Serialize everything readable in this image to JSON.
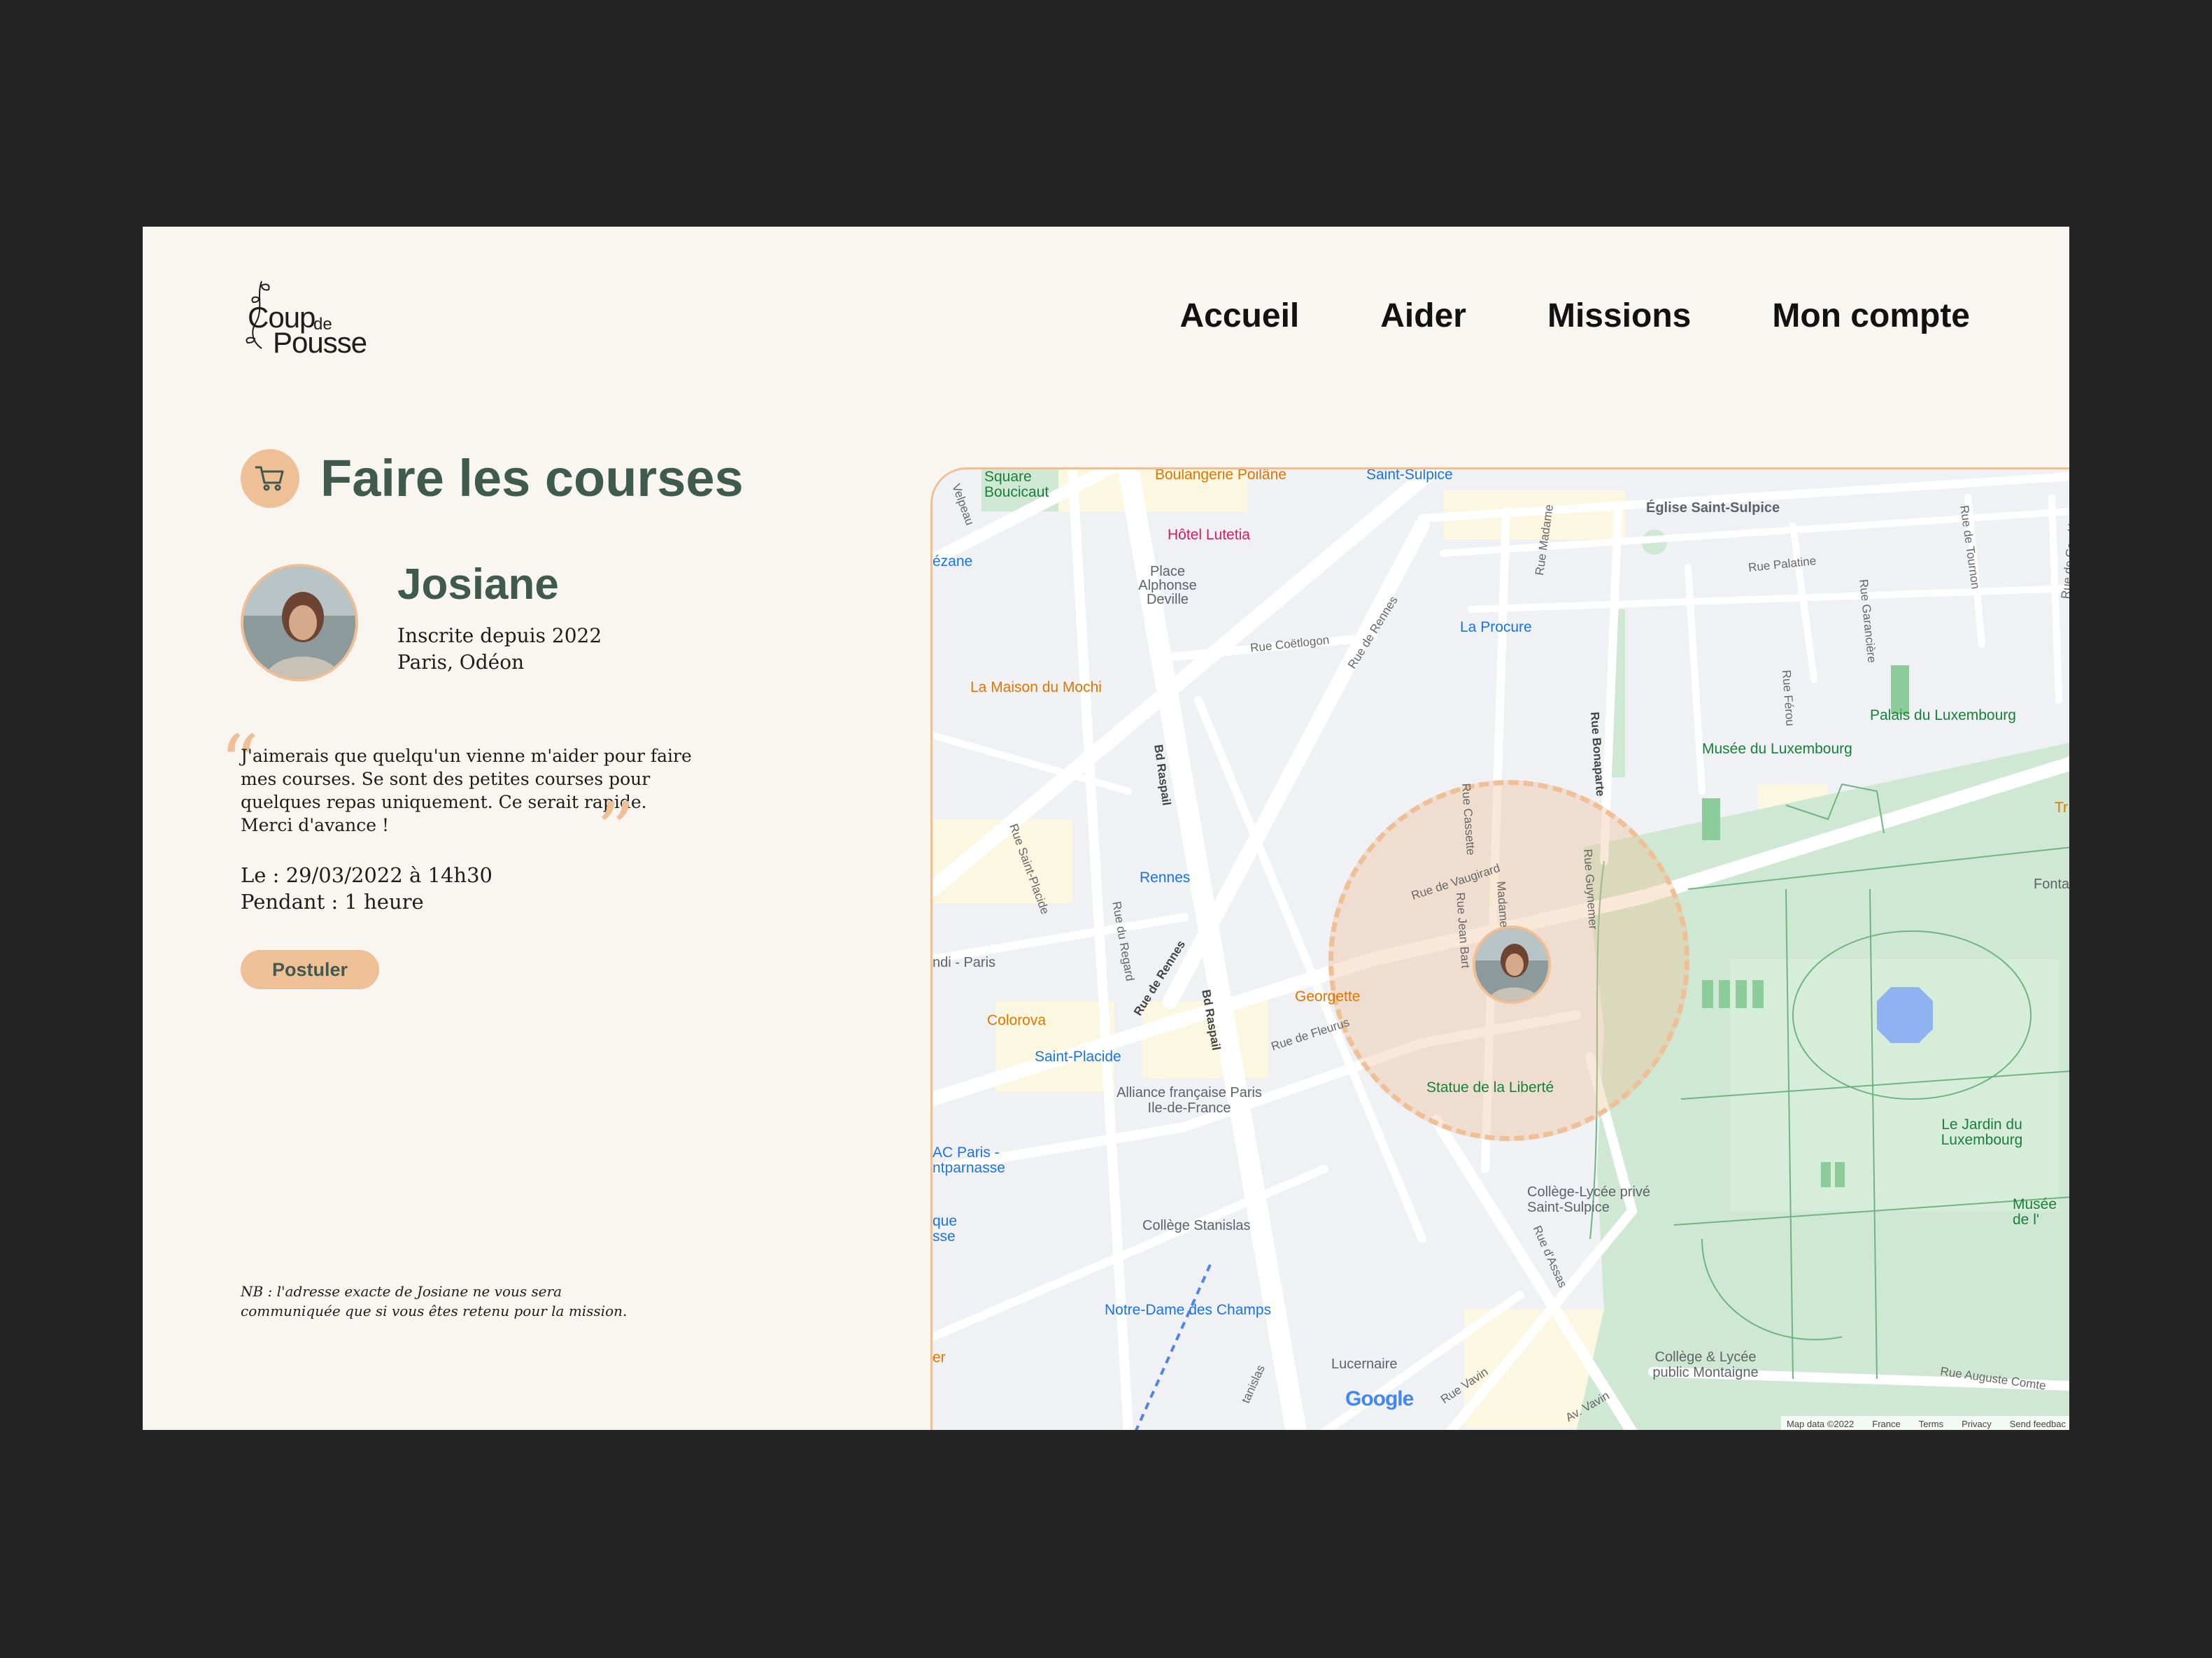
{
  "brand": {
    "line1": "Coup",
    "de": "de",
    "line2": "Pousse"
  },
  "nav": {
    "home": "Accueil",
    "help": "Aider",
    "missions": "Missions",
    "account": "Mon compte"
  },
  "mission": {
    "title": "Faire les courses",
    "icon": "cart-icon",
    "requester": "Josiane",
    "member_since": "Inscrite depuis 2022",
    "location": "Paris, Odéon",
    "quote": "J'aimerais que quelqu'un vienne m'aider pour faire mes courses. Se sont des petites courses pour quelques repas uniquement. Ce serait rapide. Merci d'avance !",
    "date": "Le : 29/03/2022 à 14h30",
    "duration": "Pendant : 1 heure",
    "apply_label": "Postuler",
    "note": "NB : l'adresse exacte de Josiane ne vous sera communiquée que si vous êtes retenu pour la mission."
  },
  "colors": {
    "accent": "#efbf96",
    "title_green": "#3f5a4f",
    "background": "#f9f6f1"
  },
  "map": {
    "places": {
      "boulangerie": "Boulangerie Poilâne",
      "saint_sulpice_metro": "Saint-Sulpice",
      "eglise": "Église Saint-Sulpice",
      "square": "Square Boucicaut",
      "hotel": "Hôtel Lutetia",
      "place_deville": "Place Alphonse Deville",
      "cezane": "ézane",
      "procure": "La Procure",
      "mochi": "La Maison du Mochi",
      "palais": "Palais du Luxembourg",
      "musee": "Musée du Luxembourg",
      "rennes": "Rennes",
      "fonta": "Fonta",
      "tr": "Tr",
      "ndi": "ndi - Paris",
      "georgette": "Georgette",
      "colorova": "Colorova",
      "saint_placide": "Saint-Placide",
      "alliance": "Alliance française Paris Ile-de-France",
      "statue": "Statue de la Liberté",
      "jardin": "Le Jardin du Luxembourg",
      "ac_paris": "AC Paris - ntparnasse",
      "college_sulpice": "Collège-Lycée privé Saint-Sulpice",
      "stanislas": "Collège Stanislas",
      "musee2": "Musée de l'",
      "que": "que sse",
      "notre_dame": "Notre-Dame des Champs",
      "er": "er",
      "college_montaigne": "Collège & Lycée public Montaigne",
      "lucernaire": "Lucernaire"
    },
    "streets": {
      "velpeau": "Velpeau",
      "madame": "Rue Madame",
      "palatine": "Rue Palatine",
      "tournon": "Rue de Tournon",
      "conde": "Rue de Condé",
      "coetlogon": "Rue Coëtlogon",
      "rennes": "Rue de Rennes",
      "garanciere": "Rue Garancière",
      "ferou": "Rue Férou",
      "raspail": "Bd Raspail",
      "bonaparte": "Rue Bonaparte",
      "cassette": "Rue Cassette",
      "saint_placide": "Rue Saint-Placide",
      "regard": "Rue du Regard",
      "vaugirard": "Rue de Vaugirard",
      "guynemer": "Rue Guynemer",
      "jean_bart": "Rue Jean Bart",
      "madame2": "Madame",
      "rennes2": "Rue de Rennes",
      "raspail2": "Bd Raspail",
      "fleurus": "Rue de Fleurus",
      "assas": "Rue d'Assas",
      "vavin": "Rue Vavin",
      "av_vavin": "Av. Vavin",
      "auguste_comte": "Rue Auguste Comte",
      "stanislas": "tanislas"
    },
    "google_logo": "Google",
    "footer": {
      "data": "Map data ©2022",
      "country": "France",
      "terms": "Terms",
      "privacy": "Privacy",
      "feedback": "Send feedbac"
    }
  }
}
